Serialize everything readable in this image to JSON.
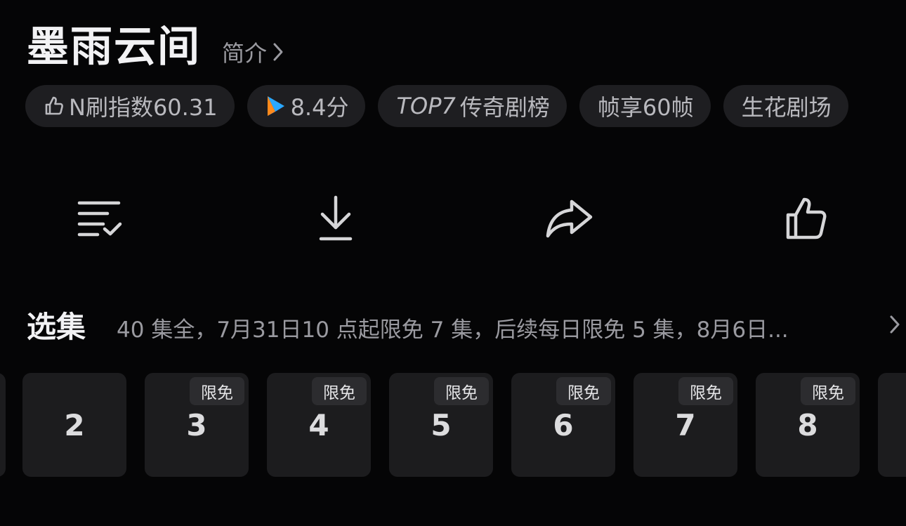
{
  "header": {
    "title": "墨雨云间",
    "intro_label": "简介"
  },
  "tags": [
    {
      "icon": "thumbs-up-icon",
      "label": "N刷指数60.31"
    },
    {
      "icon": "play-logo-icon",
      "label": "8.4分"
    },
    {
      "label_italic": "TOP7",
      "label": "传奇剧榜"
    },
    {
      "label": "帧享60帧"
    },
    {
      "label": "生花剧场"
    }
  ],
  "actions": [
    {
      "icon": "playlist-check-icon"
    },
    {
      "icon": "download-icon"
    },
    {
      "icon": "share-icon"
    },
    {
      "icon": "thumbs-up-icon"
    }
  ],
  "episodes": {
    "title": "选集",
    "note": "40 集全，7月31日10 点起限免 7 集，后续每日限免 5 集，8月6日...",
    "items": [
      {
        "number": "2",
        "badge": ""
      },
      {
        "number": "3",
        "badge": "限免"
      },
      {
        "number": "4",
        "badge": "限免"
      },
      {
        "number": "5",
        "badge": "限免"
      },
      {
        "number": "6",
        "badge": "限免"
      },
      {
        "number": "7",
        "badge": "限免"
      },
      {
        "number": "8",
        "badge": "限免"
      }
    ]
  },
  "colors": {
    "background": "#050506",
    "chip": "#1e1e21",
    "card": "#1c1c1e",
    "badge": "#2c2c2f",
    "text_primary": "#f2f2f4",
    "text_secondary": "#9a9aa0",
    "logo_blue": "#2aa8ff",
    "logo_orange": "#ff8a1c"
  }
}
